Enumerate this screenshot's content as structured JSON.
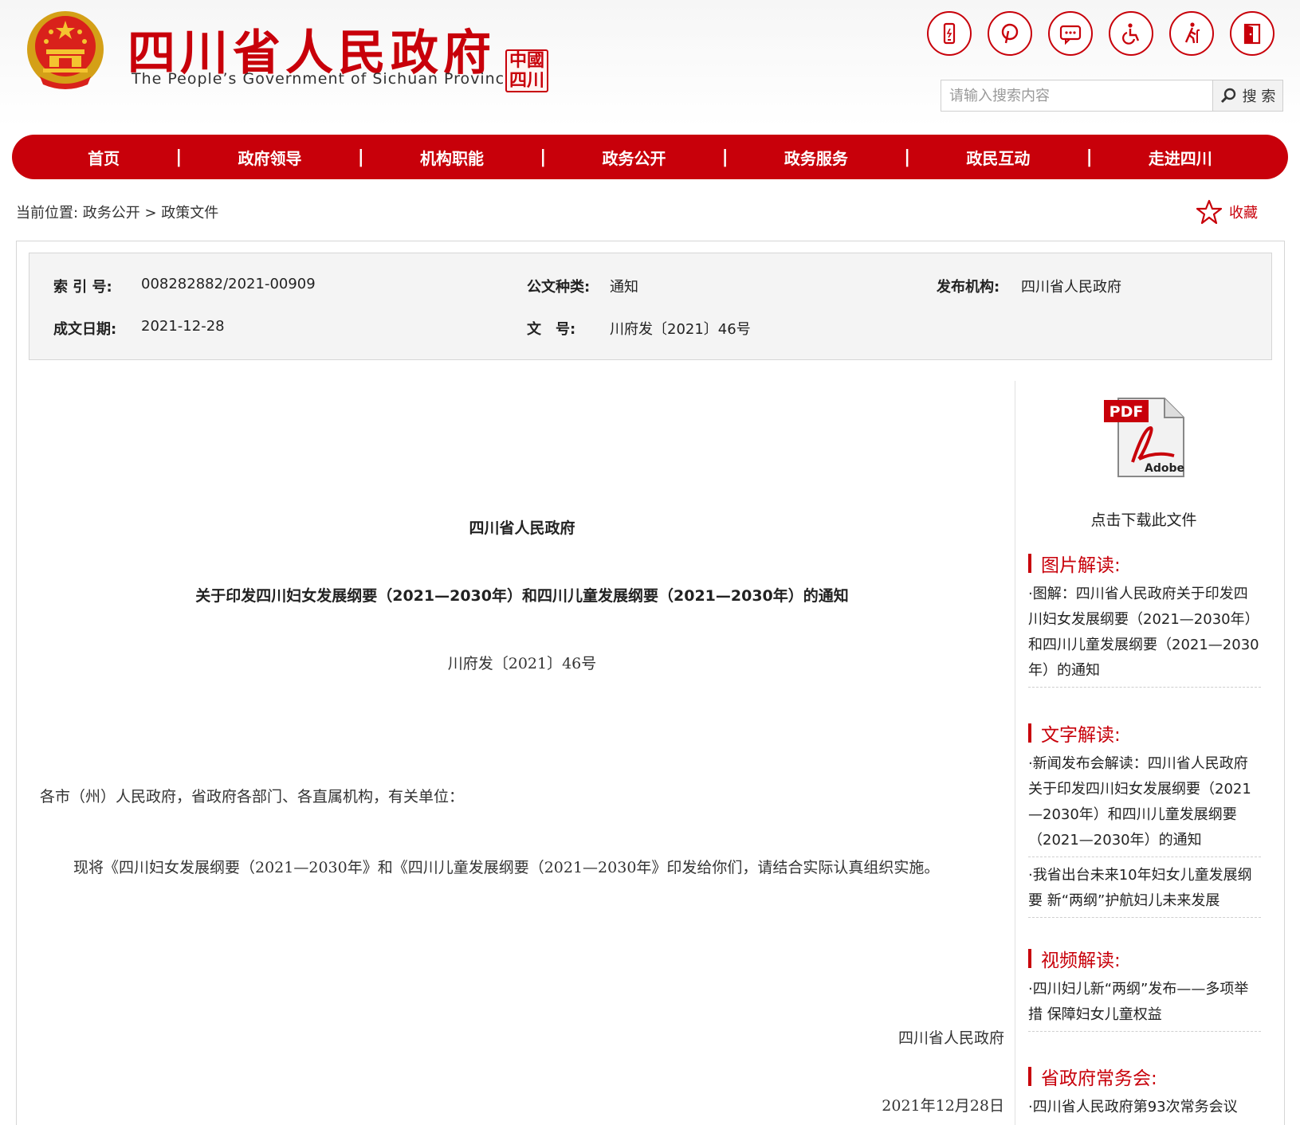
{
  "header": {
    "title": "四川省人民政府",
    "subtitle": "The People’s Government of Sichuan Province",
    "seal_text": "中国四川",
    "icons": [
      "mobile-icon",
      "pinterest-icon",
      "message-icon",
      "accessibility-icon",
      "elder-care-icon",
      "exit-icon"
    ]
  },
  "search": {
    "placeholder": "请输入搜索内容",
    "button_label": "搜 索"
  },
  "nav": {
    "items": [
      "首页",
      "政府领导",
      "机构职能",
      "政务公开",
      "政务服务",
      "政民互动",
      "走进四川"
    ],
    "separator": "|"
  },
  "breadcrumb": {
    "text": "当前位置: 政务公开 > 政策文件"
  },
  "favorite": {
    "label": "收藏"
  },
  "meta": {
    "index_label": "索 引 号:",
    "index_value": "008282882/2021-00909",
    "type_label": "公文种类:",
    "type_value": "通知",
    "publisher_label": "发布机构:",
    "publisher_value": "四川省人民政府",
    "date_label": "成文日期:",
    "date_value": "2021-12-28",
    "docnum_label": "文　号:",
    "docnum_value": "川府发〔2021〕46号"
  },
  "article": {
    "issuer": "四川省人民政府",
    "title": "关于印发四川妇女发展纲要（2021—2030年）和四川儿童发展纲要（2021—2030年）的通知",
    "doc_number": "川府发〔2021〕46号",
    "salutation": "各市（州）人民政府，省政府各部门、各直属机构，有关单位：",
    "body": "现将《四川妇女发展纲要（2021—2030年》和《四川儿童发展纲要（2021—2030年》印发给你们，请结合实际认真组织实施。",
    "sign_org": "四川省人民政府",
    "sign_date": "2021年12月28日"
  },
  "sidebar": {
    "pdf_link": "点击下载此文件",
    "sections": [
      {
        "heading": "图片解读:",
        "items": [
          "·图解：四川省人民政府关于印发四川妇女发展纲要（2021—2030年）和四川儿童发展纲要（2021—2030年）的通知"
        ]
      },
      {
        "heading": "文字解读:",
        "items": [
          "·新闻发布会解读：四川省人民政府关于印发四川妇女发展纲要（2021—2030年）和四川儿童发展纲要（2021—2030年）的通知",
          "·我省出台未来10年妇女儿童发展纲要 新“两纲”护航妇儿未来发展"
        ]
      },
      {
        "heading": "视频解读:",
        "items": [
          "·四川妇儿新“两纲”发布——多项举措 保障妇女儿童权益"
        ]
      },
      {
        "heading": "省政府常务会:",
        "items": [
          "·四川省人民政府第93次常务会议"
        ]
      }
    ]
  },
  "colors": {
    "brand_red": "#c8000a",
    "meta_bg": "#f4f4f4"
  }
}
